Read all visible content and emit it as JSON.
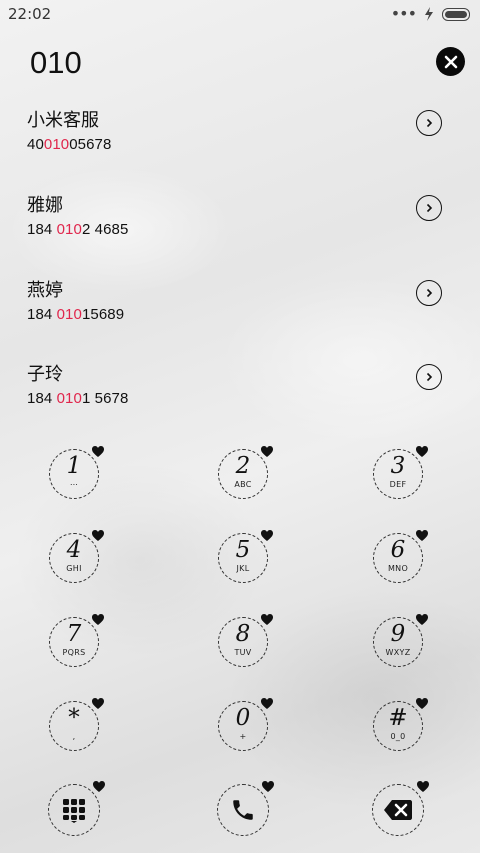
{
  "status_bar": {
    "time": "22:02",
    "dots": "•••"
  },
  "query": "010",
  "results": [
    {
      "name": "小米客服",
      "number_pre": "40",
      "number_match": "010",
      "number_post": "05678"
    },
    {
      "name": "雅娜",
      "number_pre": "184 ",
      "number_match": "010",
      "number_post": "2 4685"
    },
    {
      "name": "燕婷",
      "number_pre": "184 ",
      "number_match": "010",
      "number_post": "15689"
    },
    {
      "name": "子玲",
      "number_pre": "184 ",
      "number_match": "010",
      "number_post": "1 5678"
    }
  ],
  "keypad": [
    {
      "digit": "1",
      "letters": "⋯"
    },
    {
      "digit": "2",
      "letters": "ABC"
    },
    {
      "digit": "3",
      "letters": "DEF"
    },
    {
      "digit": "4",
      "letters": "GHI"
    },
    {
      "digit": "5",
      "letters": "JKL"
    },
    {
      "digit": "6",
      "letters": "MNO"
    },
    {
      "digit": "7",
      "letters": "PQRS"
    },
    {
      "digit": "8",
      "letters": "TUV"
    },
    {
      "digit": "9",
      "letters": "WXYZ"
    },
    {
      "digit": "*",
      "letters": ","
    },
    {
      "digit": "0",
      "letters": "+"
    },
    {
      "digit": "#",
      "letters": "0_0"
    }
  ],
  "icons": {
    "clear": "close-icon",
    "dialpad": "dialpad-icon",
    "call": "phone-icon",
    "delete": "backspace-icon"
  },
  "colors": {
    "match_highlight": "#e0264c",
    "ink": "#111111"
  }
}
